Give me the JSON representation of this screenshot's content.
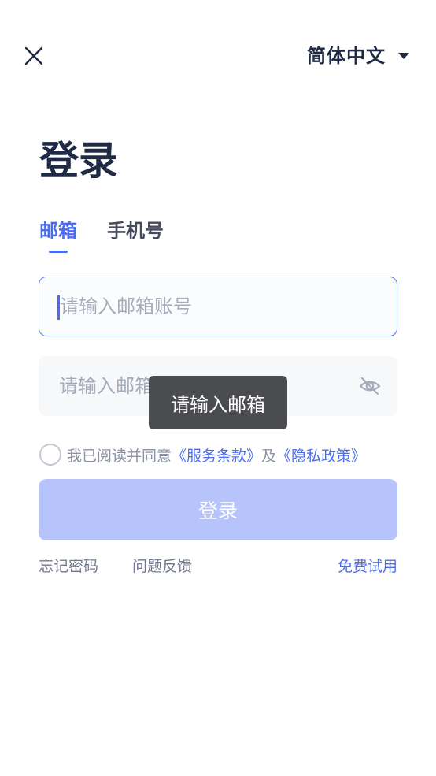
{
  "header": {
    "close_icon": "close-icon",
    "language_label": "简体中文",
    "language_caret_icon": "caret-down-icon"
  },
  "page_title": "登录",
  "tabs": [
    {
      "label": "邮箱",
      "active": true
    },
    {
      "label": "手机号",
      "active": false
    }
  ],
  "email_field": {
    "value": "",
    "placeholder": "请输入邮箱账号"
  },
  "password_field": {
    "value": "",
    "placeholder": "请输入邮箱密码",
    "visibility_icon": "eye-off-icon"
  },
  "toast": {
    "message": "请输入邮箱"
  },
  "agreement": {
    "checked": false,
    "prefix": "我已阅读并同意",
    "terms_link": "《服务条款》",
    "conjunction": "及",
    "privacy_link": "《隐私政策》"
  },
  "login_button": {
    "label": "登录"
  },
  "footer_links": {
    "forgot_password": "忘记密码",
    "feedback": "问题反馈",
    "free_trial": "免费试用"
  },
  "colors": {
    "primary": "#4b6cf0",
    "primary_disabled": "#b7c4fb",
    "text_dark": "#1f2a44",
    "toast_bg": "#4a4c50"
  }
}
